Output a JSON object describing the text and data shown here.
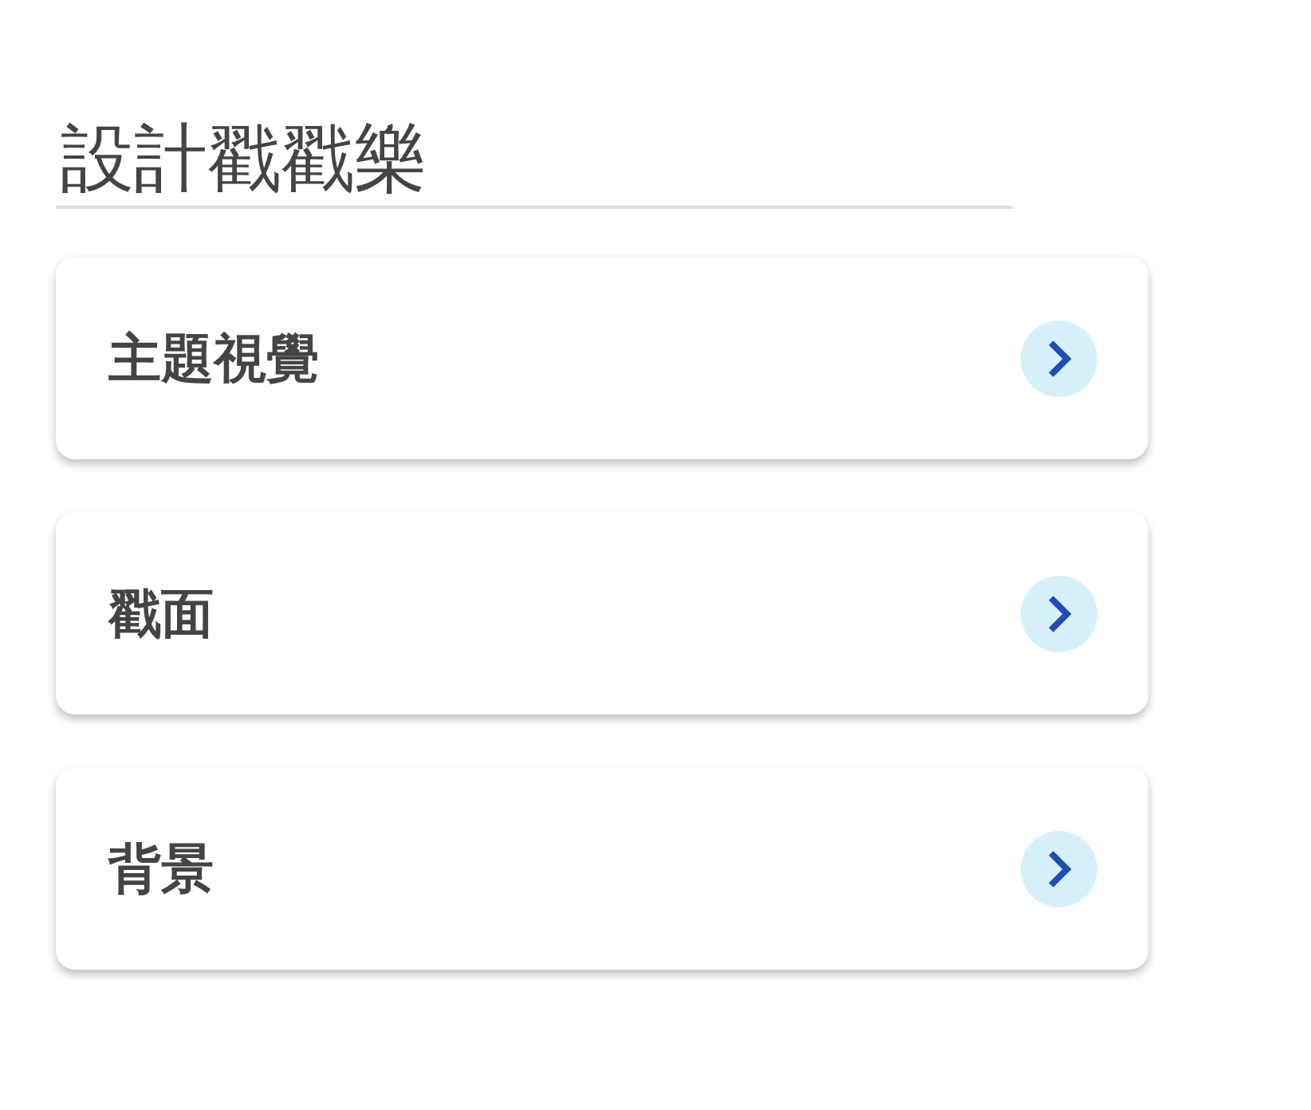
{
  "title": "設計戳戳樂",
  "items": [
    {
      "label": "主題視覺"
    },
    {
      "label": "戳面"
    },
    {
      "label": "背景"
    }
  ]
}
